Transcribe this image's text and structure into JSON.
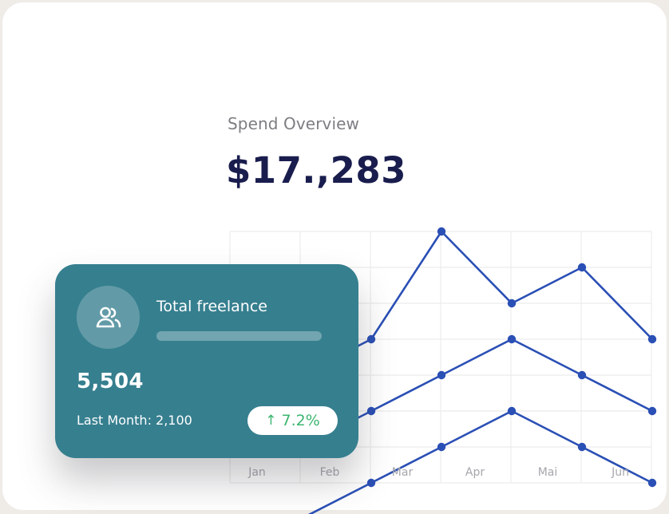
{
  "spend": {
    "title": "Spend Overview",
    "amount": "$17.,283"
  },
  "freelance_panel": {
    "title": "Total freelance",
    "icon": "users-icon",
    "value": "5,504",
    "last_month": "Last Month: 2,100",
    "change": "7.2%",
    "change_direction": "up",
    "change_icon": "arrow-up-icon"
  },
  "colors": {
    "panel": "#367f8f",
    "line": "#2a4fb5",
    "amount": "#191d4d",
    "positive": "#3bb56f",
    "grid": "#ececec"
  },
  "chart_data": {
    "type": "line",
    "categories": [
      "Jan",
      "Feb",
      "Mar",
      "Apr",
      "Mai",
      "Jun"
    ],
    "grid": true,
    "legend": "none",
    "series": [
      {
        "values": [
          4,
          3,
          0,
          2,
          1,
          3
        ],
        "extension": 1
      },
      {
        "values": [
          6,
          5,
          4,
          3,
          4,
          5
        ],
        "extension": 6
      },
      {
        "values": [
          8,
          7,
          6,
          5,
          6,
          7
        ],
        "extension": 8
      }
    ]
  }
}
